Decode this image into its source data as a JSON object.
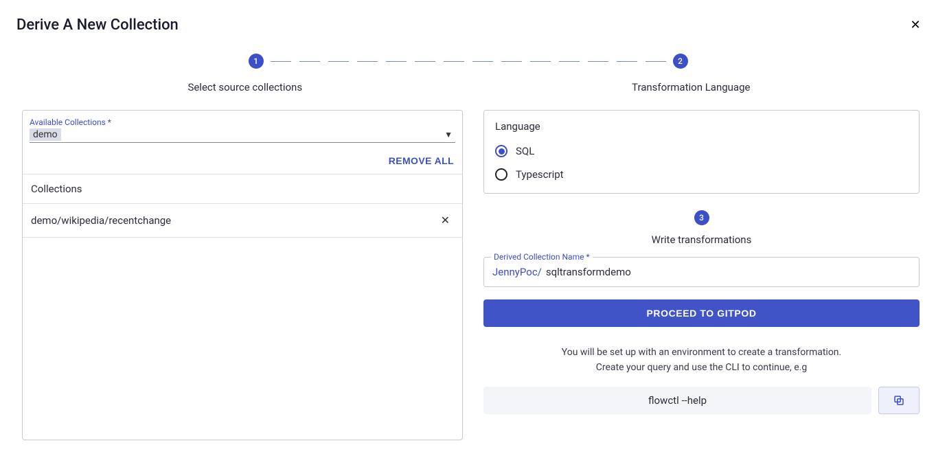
{
  "title": "Derive A New Collection",
  "stepper": {
    "step1_num": "1",
    "step2_num": "2",
    "step3_num": "3",
    "step1_label": "Select source collections",
    "step2_label": "Transformation Language",
    "step3_label": "Write transformations"
  },
  "left": {
    "available_label": "Available Collections *",
    "search_value": "demo",
    "remove_all": "REMOVE ALL",
    "collections_header": "Collections",
    "rows": [
      {
        "name": "demo/wikipedia/recentchange"
      }
    ]
  },
  "language": {
    "title": "Language",
    "options": [
      {
        "label": "SQL",
        "selected": true
      },
      {
        "label": "Typescript",
        "selected": false
      }
    ]
  },
  "derived": {
    "legend": "Derived Collection Name *",
    "prefix": "JennyPoc/",
    "value": "sqltransformdemo"
  },
  "proceed_label": "PROCEED TO GITPOD",
  "help": {
    "line1": "You will be set up with an environment to create a transformation.",
    "line2": "Create your query and use the CLI to continue, e.g"
  },
  "cli_command": "flowctl --help"
}
